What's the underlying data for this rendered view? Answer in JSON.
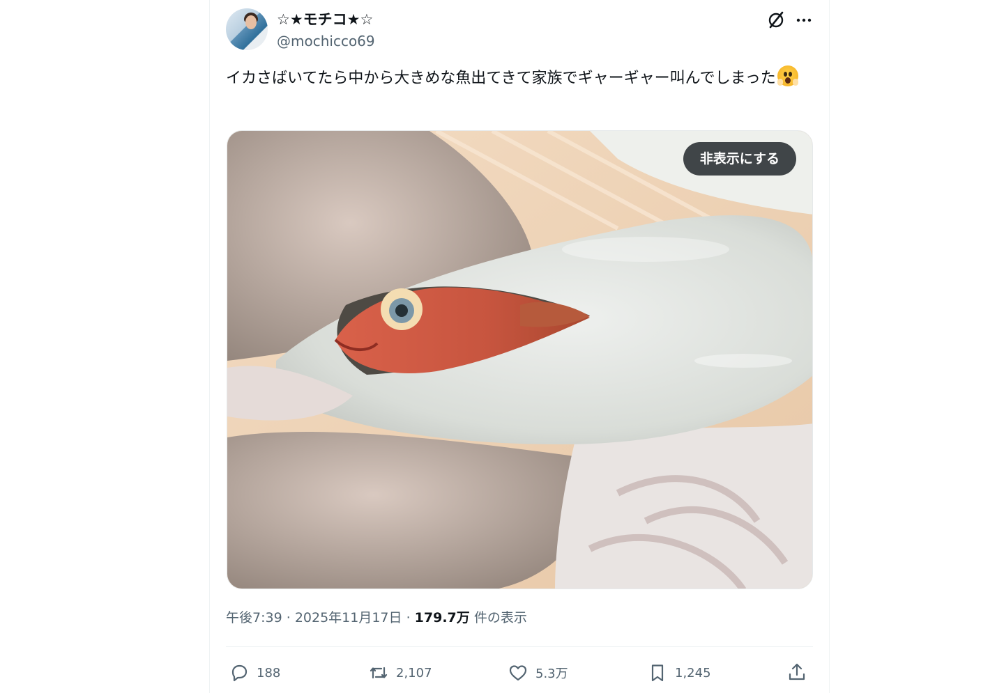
{
  "user": {
    "display_name": "☆★モチコ★☆",
    "handle": "@mochicco69"
  },
  "tweet": {
    "text": "イカさばいてたら中から大きめな魚出てきて家族でギャーギャー叫んでしまった",
    "emoji": "face-screaming-in-fear"
  },
  "media": {
    "hide_label": "非表示にする"
  },
  "meta": {
    "time": "午後7:39",
    "date": "2025年11月17日",
    "views_count": "179.7万",
    "views_label": "件の表示",
    "separator": "·"
  },
  "actions": {
    "replies": "188",
    "reposts": "2,107",
    "likes": "5.3万",
    "bookmarks": "1,245"
  },
  "icons": {
    "reply": "reply-icon",
    "repost": "repost-icon",
    "like": "like-icon",
    "bookmark": "bookmark-icon",
    "share": "share-icon",
    "grok": "grok-icon",
    "more": "more-icon"
  },
  "colors": {
    "text": "#0f1419",
    "secondary": "#536471",
    "divider": "#eff3f4"
  }
}
